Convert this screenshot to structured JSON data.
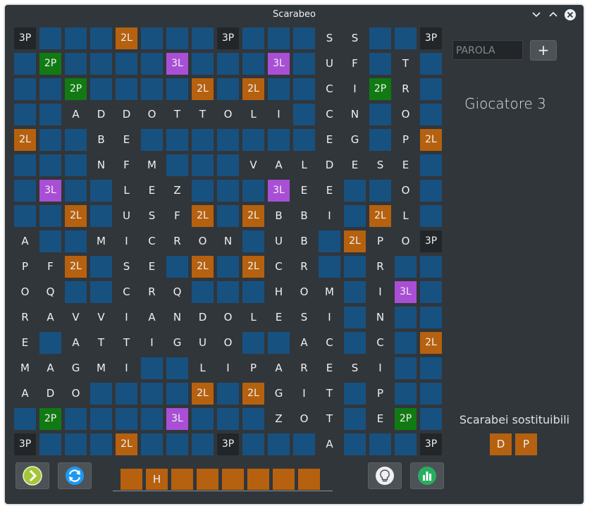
{
  "window": {
    "title": "Scarabeo"
  },
  "board": [
    [
      "3P",
      "",
      "",
      "",
      "2L",
      "",
      "",
      "",
      "3P",
      "",
      "",
      "",
      "S",
      "S",
      "",
      "",
      "3P"
    ],
    [
      "",
      "2P",
      "",
      "",
      "",
      "",
      "3L",
      "",
      "",
      "",
      "3L",
      "",
      "U",
      "F",
      "",
      "T",
      ""
    ],
    [
      "",
      "",
      "2P",
      "",
      "",
      "",
      "",
      "2L",
      "",
      "2L",
      "",
      "",
      "C",
      "I",
      "2P",
      "R",
      ""
    ],
    [
      "",
      "",
      "A",
      "D",
      "D",
      "O",
      "T",
      "T",
      "O",
      "L",
      "I",
      "",
      "C",
      "N",
      "",
      "O",
      ""
    ],
    [
      "2L",
      "",
      "",
      "B",
      "E",
      "",
      "",
      "",
      "",
      "",
      "",
      "",
      "E",
      "G",
      "",
      "P",
      "2L"
    ],
    [
      "",
      "",
      "",
      "N",
      "F",
      "M",
      "",
      "",
      "",
      "V",
      "A",
      "L",
      "D",
      "E",
      "S",
      "E",
      ""
    ],
    [
      "",
      "3L",
      "",
      "",
      "L",
      "E",
      "Z",
      "",
      "",
      "",
      "3L",
      "E",
      "E",
      "",
      "",
      "O",
      ""
    ],
    [
      "",
      "",
      "2L",
      "",
      "U",
      "S",
      "F",
      "2L",
      "",
      "2L",
      "B",
      "B",
      "I",
      "",
      "2L",
      "L",
      ""
    ],
    [
      "A",
      "",
      "",
      "M",
      "I",
      "C",
      "R",
      "O",
      "N",
      "",
      "U",
      "B",
      "",
      "2L",
      "P",
      "O",
      "3P"
    ],
    [
      "P",
      "F",
      "2L",
      "",
      "S",
      "E",
      "",
      "2L",
      "",
      "2L",
      "C",
      "R",
      "",
      "",
      "R",
      "",
      ""
    ],
    [
      "O",
      "Q",
      "",
      "",
      "C",
      "R",
      "Q",
      "",
      "",
      "",
      "H",
      "O",
      "M",
      "",
      "I",
      "3L",
      ""
    ],
    [
      "R",
      "A",
      "V",
      "V",
      "I",
      "A",
      "N",
      "D",
      "O",
      "L",
      "E",
      "S",
      "I",
      "",
      "N",
      "",
      ""
    ],
    [
      "E",
      "",
      "A",
      "T",
      "T",
      "I",
      "G",
      "U",
      "O",
      "",
      "",
      "A",
      "C",
      "",
      "C",
      "",
      "2L"
    ],
    [
      "M",
      "A",
      "G",
      "M",
      "I",
      "",
      "",
      "L",
      "I",
      "P",
      "A",
      "R",
      "E",
      "S",
      "I",
      "",
      ""
    ],
    [
      "A",
      "D",
      "O",
      "",
      "",
      "",
      "",
      "2L",
      "",
      "2L",
      "G",
      "I",
      "T",
      "",
      "P",
      "",
      ""
    ],
    [
      "",
      "2P",
      "",
      "",
      "",
      "",
      "3L",
      "",
      "",
      "",
      "Z",
      "O",
      "T",
      "",
      "E",
      "2P",
      ""
    ],
    [
      "3P",
      "",
      "",
      "",
      "2L",
      "",
      "",
      "",
      "3P",
      "",
      "",
      "",
      "A",
      "",
      "",
      "",
      "3P"
    ]
  ],
  "side": {
    "word_placeholder": "PAROLA",
    "add_label": "+",
    "player_label": "Giocatore 3",
    "substitutes_title": "Scarabei sostituibili",
    "substitutes": [
      "D",
      "P"
    ]
  },
  "rack": [
    "",
    "H",
    "",
    "",
    "",
    "",
    "",
    ""
  ],
  "colors": {
    "window_bg": "#31363b",
    "empty_cell": "#175180",
    "premium_3p": "#232629",
    "premium_2l": "#b6610f",
    "premium_2p": "#117a13",
    "premium_3l": "#a94fd6",
    "tile": "#b6610f"
  },
  "toolbar": {
    "icons": [
      "next-turn-icon",
      "swap-tiles-icon",
      "hint-icon",
      "stats-icon"
    ]
  }
}
